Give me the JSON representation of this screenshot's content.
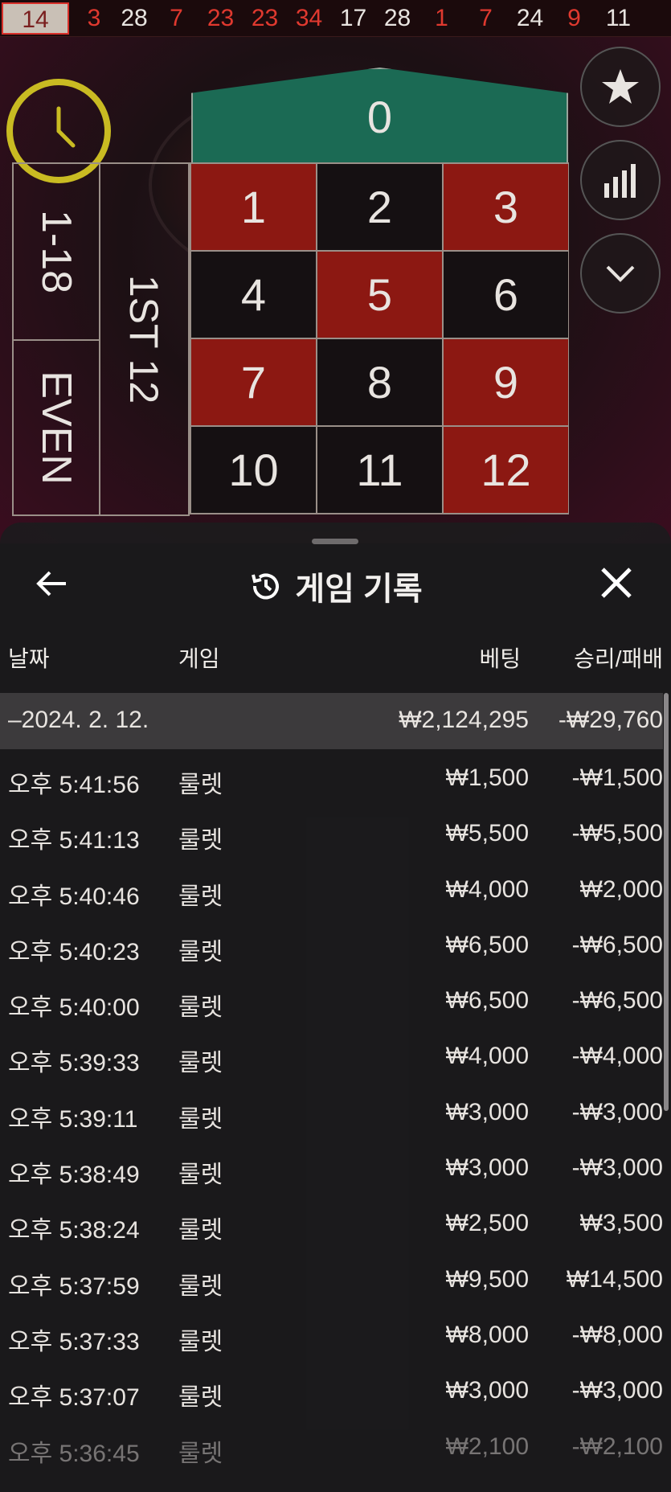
{
  "history_strip": [
    {
      "n": "14",
      "color": "black",
      "first": true
    },
    {
      "n": "3",
      "color": "red"
    },
    {
      "n": "28",
      "color": "black"
    },
    {
      "n": "7",
      "color": "red"
    },
    {
      "n": "23",
      "color": "red"
    },
    {
      "n": "23",
      "color": "red"
    },
    {
      "n": "34",
      "color": "red"
    },
    {
      "n": "17",
      "color": "black"
    },
    {
      "n": "28",
      "color": "black"
    },
    {
      "n": "1",
      "color": "red"
    },
    {
      "n": "7",
      "color": "red"
    },
    {
      "n": "24",
      "color": "black"
    },
    {
      "n": "9",
      "color": "red"
    },
    {
      "n": "11",
      "color": "black"
    }
  ],
  "board": {
    "zero": "0",
    "cells": [
      {
        "n": "1",
        "color": "red"
      },
      {
        "n": "2",
        "color": "black"
      },
      {
        "n": "3",
        "color": "red"
      },
      {
        "n": "4",
        "color": "black"
      },
      {
        "n": "5",
        "color": "red"
      },
      {
        "n": "6",
        "color": "black"
      },
      {
        "n": "7",
        "color": "red"
      },
      {
        "n": "8",
        "color": "black"
      },
      {
        "n": "9",
        "color": "red"
      },
      {
        "n": "10",
        "color": "black"
      },
      {
        "n": "11",
        "color": "black"
      },
      {
        "n": "12",
        "color": "red"
      }
    ],
    "outside_top": "1-18",
    "outside_bottom": "EVEN",
    "dozen": "1ST 12"
  },
  "side_buttons": [
    "star-icon",
    "stats-bars-icon",
    "chevron-down-icon"
  ],
  "sheet": {
    "title": "게임 기록",
    "columns": {
      "date": "날짜",
      "game": "게임",
      "bet": "베팅",
      "result": "승리/패배"
    },
    "date_group": {
      "date": "–2024. 2. 12.",
      "bet": "₩2,124,295",
      "result": "-₩29,760"
    },
    "rows": [
      {
        "time": "오후 5:41:56",
        "game": "룰렛",
        "bet": "₩1,500",
        "result": "-₩1,500"
      },
      {
        "time": "오후 5:41:13",
        "game": "룰렛",
        "bet": "₩5,500",
        "result": "-₩5,500"
      },
      {
        "time": "오후 5:40:46",
        "game": "룰렛",
        "bet": "₩4,000",
        "result": "₩2,000"
      },
      {
        "time": "오후 5:40:23",
        "game": "룰렛",
        "bet": "₩6,500",
        "result": "-₩6,500"
      },
      {
        "time": "오후 5:40:00",
        "game": "룰렛",
        "bet": "₩6,500",
        "result": "-₩6,500"
      },
      {
        "time": "오후 5:39:33",
        "game": "룰렛",
        "bet": "₩4,000",
        "result": "-₩4,000"
      },
      {
        "time": "오후 5:39:11",
        "game": "룰렛",
        "bet": "₩3,000",
        "result": "-₩3,000"
      },
      {
        "time": "오후 5:38:49",
        "game": "룰렛",
        "bet": "₩3,000",
        "result": "-₩3,000"
      },
      {
        "time": "오후 5:38:24",
        "game": "룰렛",
        "bet": "₩2,500",
        "result": "₩3,500"
      },
      {
        "time": "오후 5:37:59",
        "game": "룰렛",
        "bet": "₩9,500",
        "result": "₩14,500"
      },
      {
        "time": "오후 5:37:33",
        "game": "룰렛",
        "bet": "₩8,000",
        "result": "-₩8,000"
      },
      {
        "time": "오후 5:37:07",
        "game": "룰렛",
        "bet": "₩3,000",
        "result": "-₩3,000"
      },
      {
        "time": "오후 5:36:45",
        "game": "룰렛",
        "bet": "₩2,100",
        "result": "-₩2,100"
      }
    ]
  }
}
